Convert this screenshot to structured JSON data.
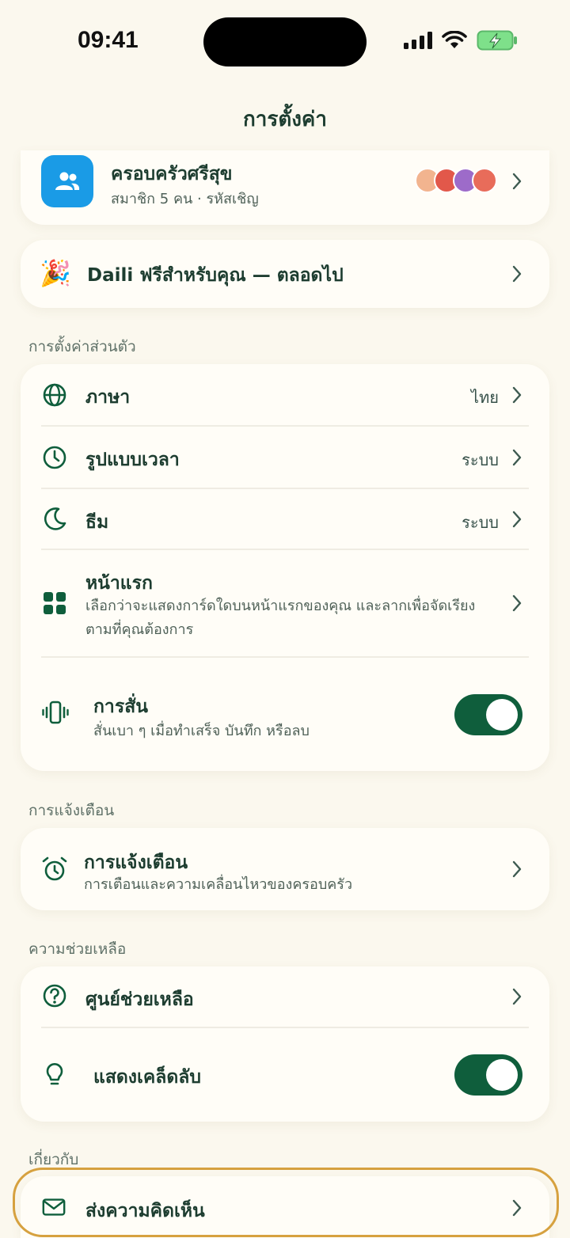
{
  "status": {
    "time": "09:41"
  },
  "nav": {
    "title": "การตั้งค่า"
  },
  "family": {
    "name": "ครอบครัวศรีสุข",
    "sub": "สมาชิก 5 คน · รหัสเชิญ"
  },
  "promo": {
    "emoji": "🎉",
    "label": "Daili ฟรีสำหรับคุณ — ตลอดไป"
  },
  "personal": {
    "header": "การตั้งค่าส่วนตัว",
    "language": {
      "label": "ภาษา",
      "value": "ไทย"
    },
    "time_format": {
      "label": "รูปแบบเวลา",
      "value": "ระบบ"
    },
    "theme": {
      "label": "ธีม",
      "value": "ระบบ"
    },
    "home": {
      "label": "หน้าแรก",
      "sub_line1": "เลือกว่าจะแสดงการ์ดใดบนหน้าแรกของคุณ และลากเพื่อจัดเรียง",
      "sub_line2": "ตามที่คุณต้องการ"
    },
    "haptics": {
      "label": "การสั่น",
      "sub": "สั่นเบา ๆ เมื่อทำเสร็จ บันทึก หรือลบ",
      "enabled": true
    }
  },
  "notifications": {
    "header": "การแจ้งเตือน",
    "item": {
      "label": "การแจ้งเตือน",
      "sub": "การเตือนและความเคลื่อนไหวของครอบครัว"
    }
  },
  "help": {
    "header": "ความช่วยเหลือ",
    "help_center": {
      "label": "ศูนย์ช่วยเหลือ"
    },
    "tips": {
      "label": "แสดงเคล็ดลับ",
      "enabled": true
    }
  },
  "about": {
    "header": "เกี่ยวกับ",
    "feedback": {
      "label": "ส่งความคิดเห็น"
    }
  },
  "colors": {
    "accent": "#0f5e3c",
    "background": "#fbf8ee",
    "card": "#fffdf7",
    "family_icon": "#1a9be6",
    "highlight": "#d6a13f"
  }
}
